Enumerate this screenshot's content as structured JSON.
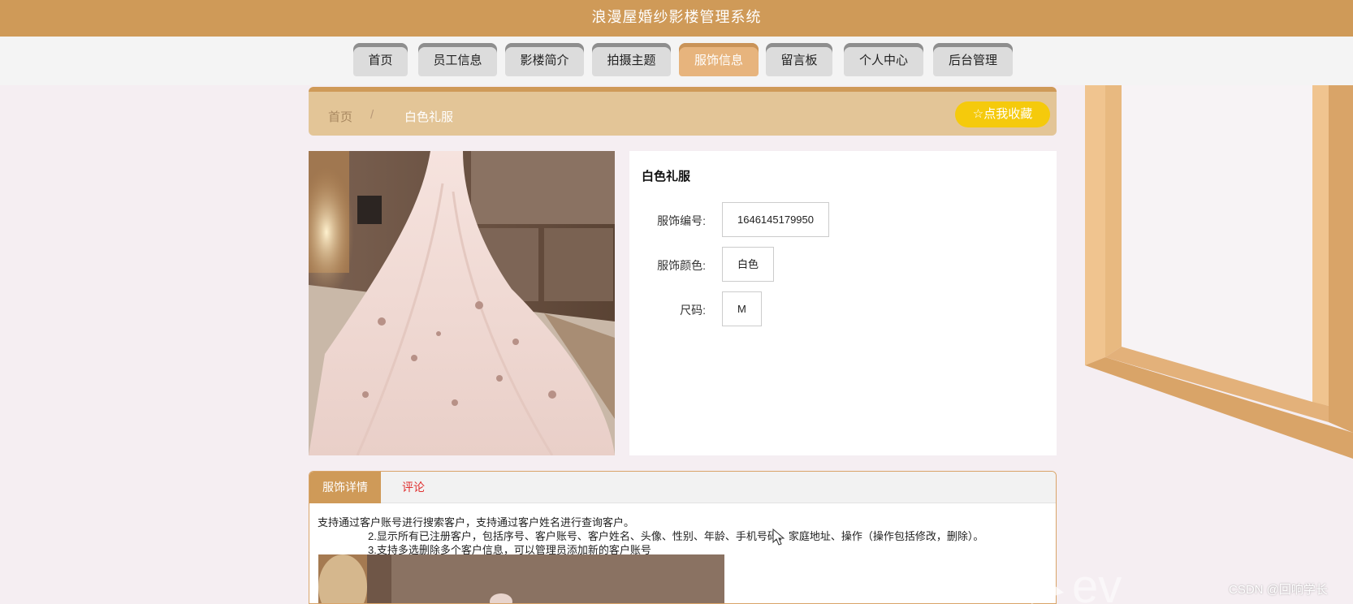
{
  "app": {
    "title": "浪漫屋婚纱影楼管理系统"
  },
  "nav": {
    "items": [
      {
        "label": "首页"
      },
      {
        "label": "员工信息"
      },
      {
        "label": "影楼简介"
      },
      {
        "label": "拍摄主题"
      },
      {
        "label": "服饰信息"
      },
      {
        "label": "留言板"
      },
      {
        "label": "个人中心"
      },
      {
        "label": "后台管理"
      }
    ],
    "active": "服饰信息"
  },
  "breadcrumb": {
    "home": "首页",
    "separator": "/",
    "current": "白色礼服"
  },
  "favorite": {
    "label": "点我收藏",
    "icon": "star-outline-icon"
  },
  "product": {
    "name": "白色礼服",
    "fields": [
      {
        "label": "服饰编号:",
        "value": "1646145179950"
      },
      {
        "label": "服饰颜色:",
        "value": "白色"
      },
      {
        "label": "尺码:",
        "value": "M"
      }
    ]
  },
  "tabs": {
    "items": [
      {
        "label": "服饰详情"
      },
      {
        "label": "评论"
      }
    ],
    "active": "服饰详情"
  },
  "detail": {
    "lines": [
      "支持通过客户账号进行搜索客户，支持通过客户姓名进行查询客户。",
      "2.显示所有已注册客户，包括序号、客户账号、客户姓名、头像、性别、年龄、手机号码、家庭地址、操作（操作包括修改，删除）。",
      "3.支持多选删除多个客户信息，可以管理员添加新的客户账号"
    ]
  },
  "watermark": {
    "text": "CSDN @回响学长"
  },
  "colors": {
    "header": "#cf9a58",
    "nav_active": "#e7b47d",
    "breadcrumb_bg": "#e3c597",
    "favorite_bg": "#f5ca0c",
    "page_bg": "#f5eef2",
    "tab_inactive_text": "#e03030"
  }
}
